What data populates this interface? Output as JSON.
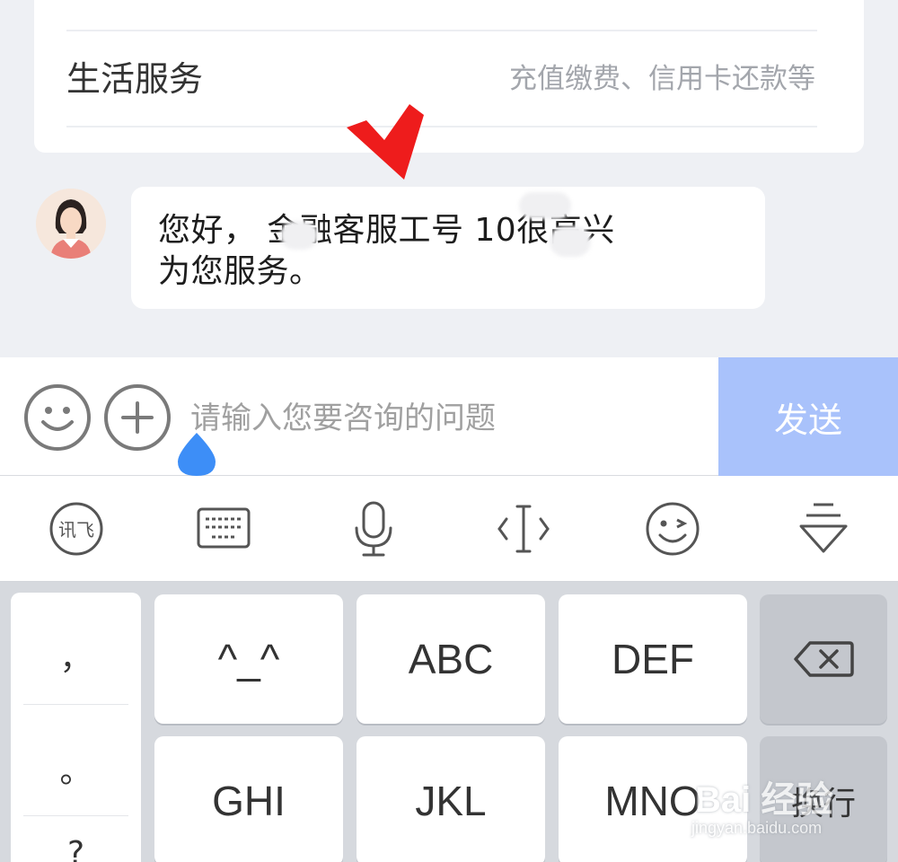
{
  "service": {
    "title": "生活服务",
    "description": "充值缴费、信用卡还款等"
  },
  "chat": {
    "message_line1": "您好，  金融客服工号  10很高兴",
    "message_line2": "为您服务。"
  },
  "input_bar": {
    "placeholder": "请输入您要咨询的问题",
    "send_label": "发送",
    "send_color": "#a9c2fb"
  },
  "toolbar": {
    "icons": [
      "xunfei-logo-icon",
      "keyboard-icon",
      "microphone-icon",
      "cursor-move-icon",
      "wink-emoji-icon",
      "collapse-keyboard-icon"
    ]
  },
  "keyboard": {
    "symbols": [
      "，",
      "。"
    ],
    "keys_row1": [
      "^_^",
      "ABC",
      "DEF"
    ],
    "keys_row2": [
      "GHI",
      "JKL",
      "MNO"
    ],
    "enter_label": "换行"
  },
  "watermark": {
    "brand": "Bai 经验",
    "url": "jingyan.baidu.com"
  },
  "annotation": {
    "arrow_color": "#ee1c1c"
  }
}
